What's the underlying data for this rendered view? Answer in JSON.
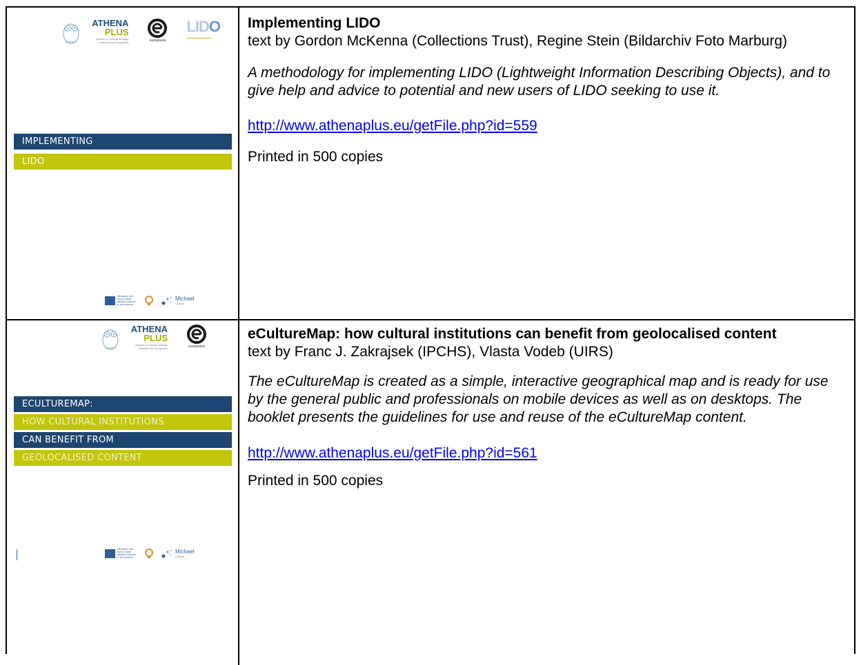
{
  "entries": [
    {
      "cover": {
        "logos": {
          "athena_line1": "ATHENA",
          "athena_line2": "PLUS",
          "athena_tag": "Access to cultural heritage networks for Europeana",
          "europeana_label": "europeana",
          "lido_l": "LID",
          "lido_o": "O"
        },
        "bands": [
          "IMPLEMENTING",
          "LIDO"
        ],
        "footer": {
          "mibac_text": "Ministero dei beni e delle attività culturali e del turismo",
          "michael_text": "Michael",
          "michael_sub": "Culture"
        }
      },
      "title": "Implementing LIDO",
      "author": "text by Gordon McKenna (Collections Trust), Regine Stein (Bildarchiv Foto Marburg)",
      "abstract": "A methodology for implementing LIDO (Lightweight Information Describing Objects), and to give help and advice to potential and new users of LIDO seeking to use it.",
      "link": "http://www.athenaplus.eu/getFile.php?id=559",
      "copies": "Printed in 500 copies"
    },
    {
      "cover": {
        "logos": {
          "athena_line1": "ATHENA",
          "athena_line2": "PLUS",
          "athena_tag": "Access to cultural heritage networks for Europeana",
          "europeana_label": "europeana"
        },
        "bands": [
          "ECULTUREMAP:",
          "HOW CULTURAL INSTITUTIONS",
          "CAN BENEFIT FROM",
          "GEOLOCALISED CONTENT"
        ],
        "footer": {
          "mibac_text": "Ministero dei beni e delle attività culturali e del turismo",
          "michael_text": "Michael",
          "michael_sub": "Culture"
        }
      },
      "title": "eCultureMap: how cultural institutions can benefit from geolocalised content",
      "author": "text by Franc J. Zakrajsek (IPCHS), Vlasta Vodeb (UIRS)",
      "abstract": "The eCultureMap is created as a simple, interactive geographical map and is ready for use by the general public and professionals on mobile devices as well as on desktops. The booklet presents the guidelines for use and reuse of the eCultureMap content.",
      "link": "http://www.athenaplus.eu/getFile.php?id=561",
      "copies": "Printed in 500 copies"
    }
  ],
  "colors": {
    "band_blue": "#1c4671",
    "band_green": "#c3c60c",
    "link": "#0000ee"
  }
}
